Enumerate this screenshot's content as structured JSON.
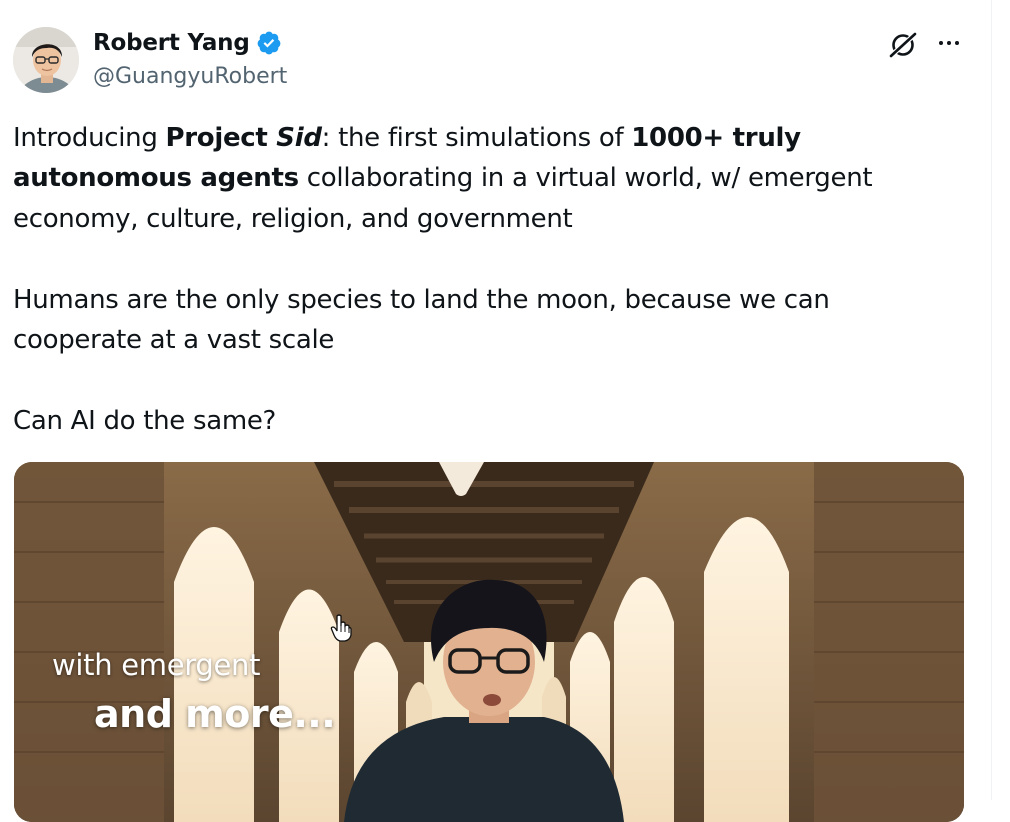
{
  "author": {
    "name": "Robert Yang",
    "handle": "@GuangyuRobert",
    "verified": true,
    "verified_color": "#1d9bf0"
  },
  "header_icons": {
    "grok": "grok-icon",
    "more": "more-horizontal-icon"
  },
  "tweet": {
    "para1": {
      "t1": "Introducing ",
      "t2": "Project ",
      "t3": "Sid",
      "t4": ": the first simulations of ",
      "t5": "1000+ truly autonomous agents",
      "t6": " collaborating in a virtual world, w/ emergent economy, culture, religion, and government"
    },
    "para2": "Humans are the only species to land the moon, because we can cooperate at a vast scale",
    "para3": "Can AI do the same?"
  },
  "media": {
    "type": "video",
    "caption_line1": "with emergent",
    "caption_line2": "and more..."
  },
  "colors": {
    "text": "#0f1419",
    "secondary": "#536471",
    "divider": "#eff3f4"
  }
}
